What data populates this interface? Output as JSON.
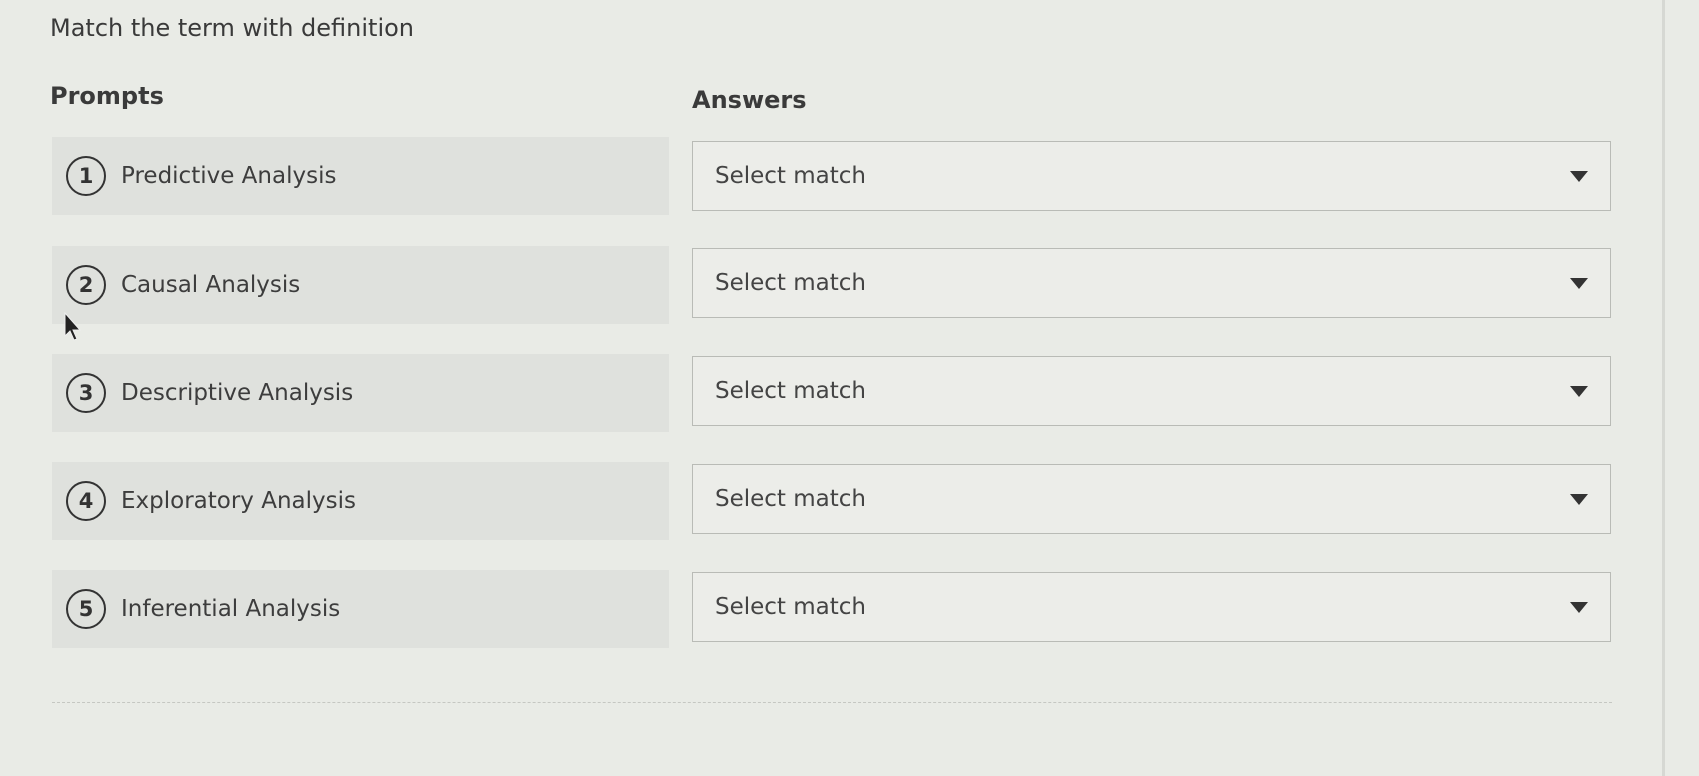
{
  "question": {
    "title": "Match the term with definition"
  },
  "columns": {
    "prompts_label": "Prompts",
    "answers_label": "Answers"
  },
  "prompts": [
    {
      "number": "1",
      "text": "Predictive Analysis"
    },
    {
      "number": "2",
      "text": "Causal Analysis"
    },
    {
      "number": "3",
      "text": "Descriptive Analysis"
    },
    {
      "number": "4",
      "text": "Exploratory Analysis"
    },
    {
      "number": "5",
      "text": "Inferential Analysis"
    }
  ],
  "answers": [
    {
      "value": "Select match"
    },
    {
      "value": "Select match"
    },
    {
      "value": "Select match"
    },
    {
      "value": "Select match"
    },
    {
      "value": "Select match"
    }
  ],
  "icons": {
    "dropdown": "chevron-down-icon",
    "cursor": "mouse-pointer-icon"
  },
  "colors": {
    "background": "#e9ebe6",
    "prompt_row": "#dfe1dd",
    "text": "#3a3a3a",
    "border": "#b9bbb6"
  }
}
